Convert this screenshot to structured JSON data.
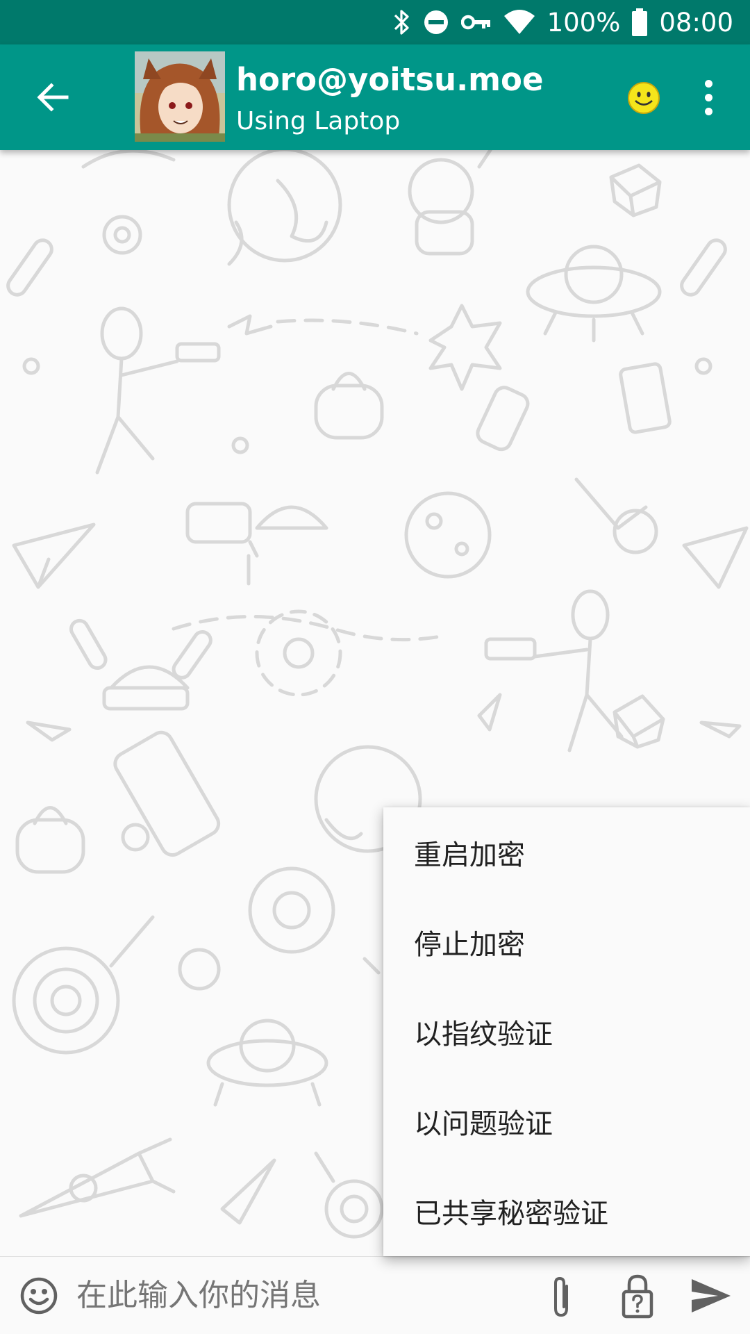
{
  "status_bar": {
    "battery": "100%",
    "time": "08:00",
    "icons": [
      "bluetooth-icon",
      "do-not-disturb-icon",
      "vpn-key-icon",
      "wifi-icon",
      "battery-icon"
    ]
  },
  "app_bar": {
    "contact_name": "horo@yoitsu.moe",
    "contact_status": "Using Laptop",
    "color": "#009688",
    "status_bar_color": "#00796b"
  },
  "menu": {
    "items": [
      {
        "label": "重启加密"
      },
      {
        "label": "停止加密"
      },
      {
        "label": "以指纹验证"
      },
      {
        "label": "以问题验证"
      },
      {
        "label": "已共享秘密验证"
      }
    ]
  },
  "input_bar": {
    "placeholder": "在此输入你的消息"
  }
}
